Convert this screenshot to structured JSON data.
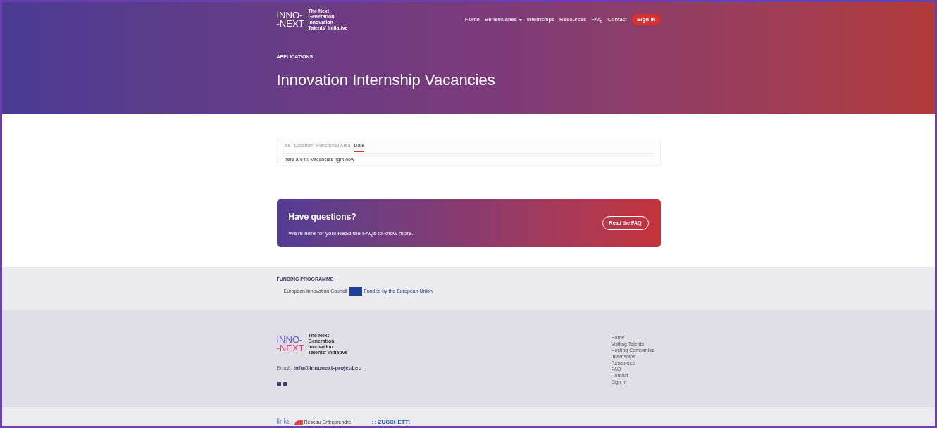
{
  "header": {
    "logo": {
      "mark_top": "INNO-",
      "mark_bottom": "-NEXT",
      "tagline": [
        "The Next",
        "Generation",
        "Innovation",
        "Talents' Initiative"
      ]
    },
    "nav": [
      {
        "label": "Home",
        "dropdown": false
      },
      {
        "label": "Beneficiaries",
        "dropdown": true
      },
      {
        "label": "Internships",
        "dropdown": false
      },
      {
        "label": "Resources",
        "dropdown": false
      },
      {
        "label": "FAQ",
        "dropdown": false
      },
      {
        "label": "Contact",
        "dropdown": false
      }
    ],
    "sign_in": "Sign In"
  },
  "hero": {
    "eyebrow": "APPLICATIONS",
    "title": "Innovation Internship Vacancies"
  },
  "vacancies": {
    "tabs": [
      {
        "label": "Title",
        "selected": false
      },
      {
        "label": "Location",
        "selected": false
      },
      {
        "label": "Functional Area",
        "selected": false
      },
      {
        "label": "Date",
        "selected": true
      }
    ],
    "message": "There are no vacancies right now"
  },
  "cta": {
    "title": "Have questions?",
    "text": "We're here for you! Read the FAQs to know more.",
    "button": "Read the FAQ"
  },
  "funding": {
    "label": "FUNDING PROGRAMME",
    "eic": "European Innovation Council",
    "eu": "Funded by the European Union"
  },
  "footer": {
    "logo": {
      "mark_top": "INNO-",
      "mark_bottom": "-NEXT",
      "tagline": [
        "The Next",
        "Generation",
        "Innovation",
        "Talents' Initiative"
      ]
    },
    "email_label": "Email:",
    "email": "info@innonext-project.eu",
    "links": [
      "Home",
      "Visiting Talents",
      "Hosting Companies",
      "Internships",
      "Resources",
      "FAQ",
      "Contact",
      "Sign In"
    ]
  },
  "partners": {
    "links": "links",
    "reseau": "Réseau Entreprendre",
    "zucchetti": "ZUCCHETTI"
  }
}
